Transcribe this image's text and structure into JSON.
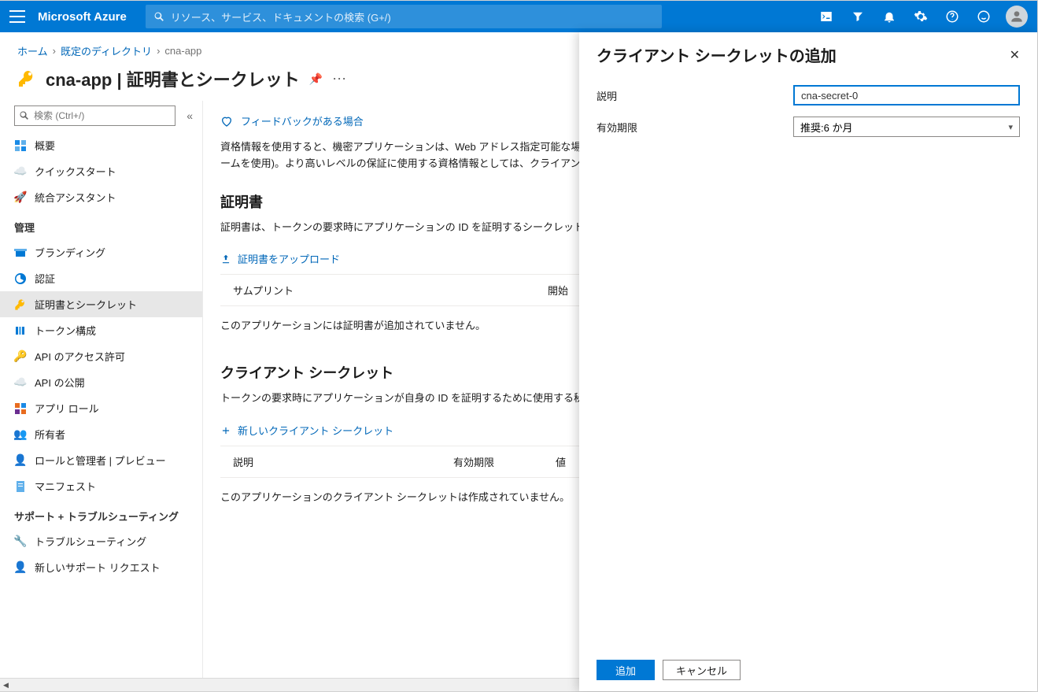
{
  "topbar": {
    "brand": "Microsoft Azure",
    "search_placeholder": "リソース、サービス、ドキュメントの検索 (G+/)"
  },
  "breadcrumb": {
    "home": "ホーム",
    "dir": "既定のディレクトリ",
    "current": "cna-app"
  },
  "page": {
    "title": "cna-app | 証明書とシークレット"
  },
  "sidebar": {
    "search_placeholder": "検索 (Ctrl+/)",
    "items_top": [
      {
        "label": "概要",
        "icon": "overview"
      },
      {
        "label": "クイックスタート",
        "icon": "quickstart"
      },
      {
        "label": "統合アシスタント",
        "icon": "rocket"
      }
    ],
    "group1": "管理",
    "items_m": [
      {
        "label": "ブランディング",
        "icon": "branding"
      },
      {
        "label": "認証",
        "icon": "auth"
      },
      {
        "label": "証明書とシークレット",
        "icon": "key",
        "sel": true
      },
      {
        "label": "トークン構成",
        "icon": "token"
      },
      {
        "label": "API のアクセス許可",
        "icon": "apiperm"
      },
      {
        "label": "API の公開",
        "icon": "apiexp"
      },
      {
        "label": "アプリ ロール",
        "icon": "approle"
      },
      {
        "label": "所有者",
        "icon": "owners"
      },
      {
        "label": "ロールと管理者 | プレビュー",
        "icon": "roles"
      },
      {
        "label": "マニフェスト",
        "icon": "manifest"
      }
    ],
    "group2": "サポート + トラブルシューティング",
    "items_s": [
      {
        "label": "トラブルシューティング",
        "icon": "trouble"
      },
      {
        "label": "新しいサポート リクエスト",
        "icon": "support"
      }
    ]
  },
  "main": {
    "feedback": "フィードバックがある場合",
    "intro1": "資格情報を使用すると、機密アプリケーションは、Web アドレス指定可能な場所で",
    "intro2": "ームを使用)。より高いレベルの保証に使用する資格情報としては、クライアント シ",
    "cert_hdr": "証明書",
    "cert_desc": "証明書は、トークンの要求時にアプリケーションの ID を証明するシークレットとし",
    "cert_upload": "証明書をアップロード",
    "cert_th1": "サムプリント",
    "cert_th2": "開始",
    "cert_empty": "このアプリケーションには証明書が追加されていません。",
    "secret_hdr": "クライアント シークレット",
    "secret_desc": "トークンの要求時にアプリケーションが自身の ID を証明するために使用する秘密",
    "secret_new": "新しいクライアント シークレット",
    "secret_th1": "説明",
    "secret_th2": "有効期限",
    "secret_th3": "値",
    "secret_empty": "このアプリケーションのクライアント シークレットは作成されていません。"
  },
  "panel": {
    "title": "クライアント シークレットの追加",
    "label_desc": "説明",
    "value_desc": "cna-secret-0",
    "label_exp": "有効期限",
    "value_exp": "推奨:6 か月",
    "btn_add": "追加",
    "btn_cancel": "キャンセル"
  }
}
